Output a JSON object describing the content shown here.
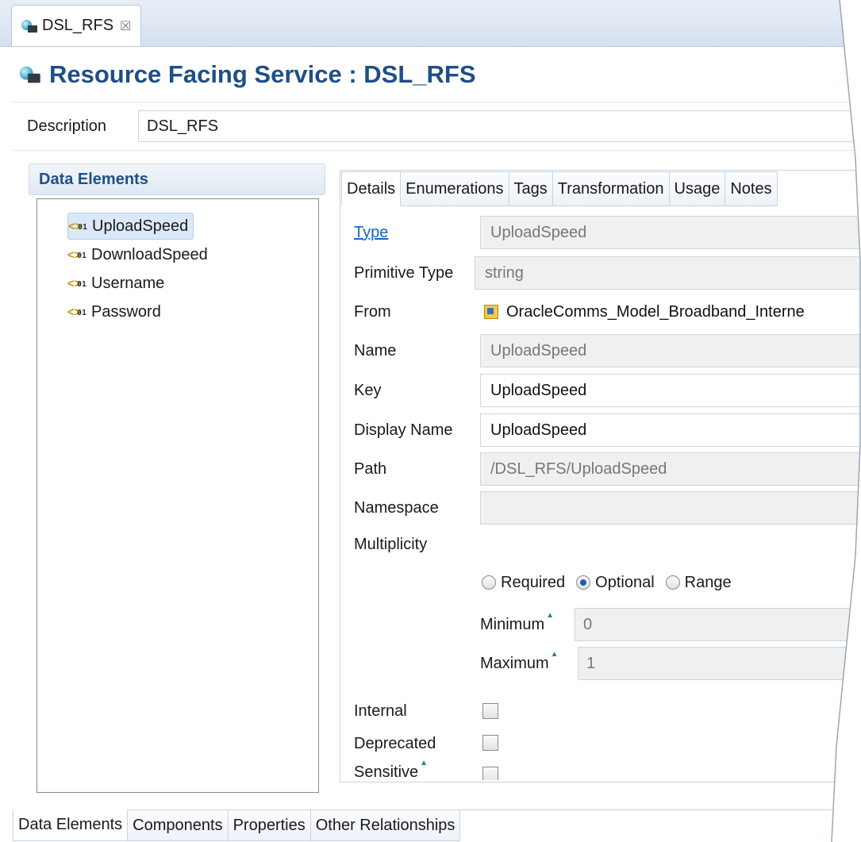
{
  "editor_tab": {
    "label": "DSL_RFS",
    "close_glyph": "☒"
  },
  "header": {
    "title": "Resource Facing Service : DSL_RFS"
  },
  "description": {
    "label": "Description",
    "value": "DSL_RFS"
  },
  "data_elements": {
    "header": "Data Elements",
    "items": [
      {
        "label": "UploadSpeed",
        "selected": true
      },
      {
        "label": "DownloadSpeed",
        "selected": false
      },
      {
        "label": "Username",
        "selected": false
      },
      {
        "label": "Password",
        "selected": false
      }
    ]
  },
  "details_tabs": [
    "Details",
    "Enumerations",
    "Tags",
    "Transformation",
    "Usage",
    "Notes"
  ],
  "fields": {
    "type": {
      "label": "Type",
      "value": "UploadSpeed"
    },
    "primitive_type": {
      "label": "Primitive Type",
      "value": "string"
    },
    "from": {
      "label": "From",
      "value": "OracleComms_Model_Broadband_Interne"
    },
    "name": {
      "label": "Name",
      "value": "UploadSpeed"
    },
    "key": {
      "label": "Key",
      "value": "UploadSpeed"
    },
    "display_name": {
      "label": "Display Name",
      "value": "UploadSpeed"
    },
    "path": {
      "label": "Path",
      "value": "/DSL_RFS/UploadSpeed"
    },
    "namespace": {
      "label": "Namespace",
      "value": ""
    },
    "multiplicity": {
      "label": "Multiplicity"
    }
  },
  "multiplicity": {
    "options": [
      "Required",
      "Optional",
      "Range"
    ],
    "selected": "Optional",
    "minimum": {
      "label": "Minimum",
      "value": "0"
    },
    "maximum": {
      "label": "Maximum",
      "value": "1"
    }
  },
  "flags": {
    "internal": {
      "label": "Internal",
      "checked": false
    },
    "deprecated": {
      "label": "Deprecated",
      "checked": false
    },
    "sensitive": {
      "label": "Sensitive",
      "checked": false
    }
  },
  "bottom_tabs": [
    "Data Elements",
    "Components",
    "Properties",
    "Other Relationships"
  ],
  "colors": {
    "title": "#1e4f86",
    "link": "#1565c0",
    "selection": "#dbe8f7",
    "radio_on": "#1d5fb5"
  },
  "icons": {
    "service": "service-icon",
    "data_element": "data-element-icon",
    "from": "project-icon"
  }
}
